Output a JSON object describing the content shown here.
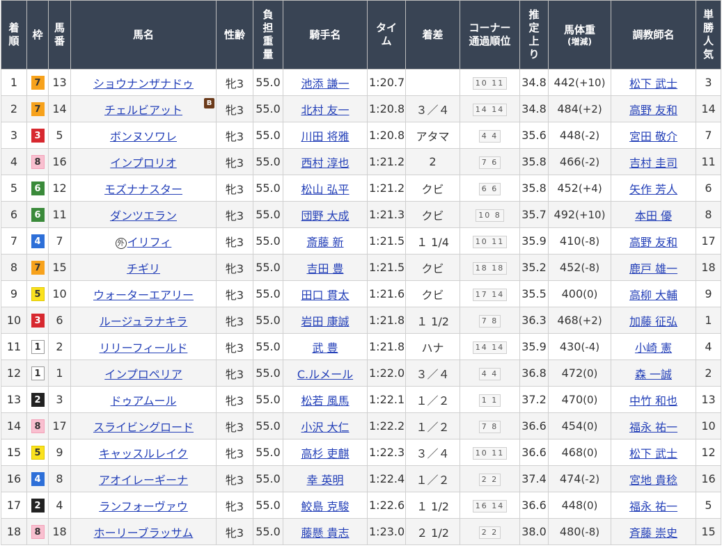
{
  "headers": {
    "rank": "着\n順",
    "waku": "枠",
    "num": "馬\n番",
    "horse": "馬名",
    "sexage": "性齢",
    "burden": "負\n担\n重\n量",
    "jockey": "騎手名",
    "time": "タイ\nム",
    "margin": "着差",
    "corner": "コーナー\n通過順位",
    "last3f": "推\n定\n上\nり",
    "weight": "馬体重",
    "weight_sub": "(増減)",
    "trainer": "調教師名",
    "pop": "単\n勝\n人\n気"
  },
  "waku_colors": {
    "1": {
      "bg": "#ffffff",
      "fg": "#333333",
      "border": "#999999"
    },
    "2": {
      "bg": "#222222",
      "fg": "#ffffff",
      "border": "#222222"
    },
    "3": {
      "bg": "#d7282f",
      "fg": "#ffffff",
      "border": "#d7282f"
    },
    "4": {
      "bg": "#2d6fd8",
      "fg": "#ffffff",
      "border": "#2d6fd8"
    },
    "5": {
      "bg": "#fbe21e",
      "fg": "#333333",
      "border": "#e0c800"
    },
    "6": {
      "bg": "#3a8a3a",
      "fg": "#ffffff",
      "border": "#3a8a3a"
    },
    "7": {
      "bg": "#f7a21c",
      "fg": "#333333",
      "border": "#f7a21c"
    },
    "8": {
      "bg": "#f9c0d0",
      "fg": "#333333",
      "border": "#f3a0b8"
    }
  },
  "rows": [
    {
      "rank": "1",
      "waku": "7",
      "num": "13",
      "horse": "ショウナンザナドゥ",
      "blinker": "",
      "mark": "",
      "sexage": "牝3",
      "burden": "55.0",
      "jockey": "池添 謙一",
      "time": "1:20.7",
      "margin": "",
      "corner": "10 11",
      "last3f": "34.8",
      "weight": "442",
      "diff": "(+10)",
      "trainer": "松下 武士",
      "pop": "3"
    },
    {
      "rank": "2",
      "waku": "7",
      "num": "14",
      "horse": "チェルビアット",
      "blinker": "B",
      "mark": "",
      "sexage": "牝3",
      "burden": "55.0",
      "jockey": "北村 友一",
      "time": "1:20.8",
      "margin": "３／４",
      "corner": "14 14",
      "last3f": "34.8",
      "weight": "484",
      "diff": "(+2)",
      "trainer": "高野 友和",
      "pop": "14"
    },
    {
      "rank": "3",
      "waku": "3",
      "num": "5",
      "horse": "ボンヌソワレ",
      "blinker": "",
      "mark": "",
      "sexage": "牝3",
      "burden": "55.0",
      "jockey": "川田 将雅",
      "time": "1:20.8",
      "margin": "アタマ",
      "corner": "4 4",
      "last3f": "35.6",
      "weight": "448",
      "diff": "(-2)",
      "trainer": "宮田 敬介",
      "pop": "7"
    },
    {
      "rank": "4",
      "waku": "8",
      "num": "16",
      "horse": "インプロリオ",
      "blinker": "",
      "mark": "",
      "sexage": "牝3",
      "burden": "55.0",
      "jockey": "西村 淳也",
      "time": "1:21.2",
      "margin": "2",
      "corner": "7 6",
      "last3f": "35.8",
      "weight": "466",
      "diff": "(-2)",
      "trainer": "吉村 圭司",
      "pop": "11"
    },
    {
      "rank": "5",
      "waku": "6",
      "num": "12",
      "horse": "モズナナスター",
      "blinker": "",
      "mark": "",
      "sexage": "牝3",
      "burden": "55.0",
      "jockey": "松山 弘平",
      "time": "1:21.2",
      "margin": "クビ",
      "corner": "6 6",
      "last3f": "35.8",
      "weight": "452",
      "diff": "(+4)",
      "trainer": "矢作 芳人",
      "pop": "6"
    },
    {
      "rank": "6",
      "waku": "6",
      "num": "11",
      "horse": "ダンツエラン",
      "blinker": "",
      "mark": "",
      "sexage": "牝3",
      "burden": "55.0",
      "jockey": "団野 大成",
      "time": "1:21.3",
      "margin": "クビ",
      "corner": "10 8",
      "last3f": "35.7",
      "weight": "492",
      "diff": "(+10)",
      "trainer": "本田 優",
      "pop": "8"
    },
    {
      "rank": "7",
      "waku": "4",
      "num": "7",
      "horse": "イリフィ",
      "blinker": "",
      "mark": "外",
      "sexage": "牝3",
      "burden": "55.0",
      "jockey": "斎藤 新",
      "time": "1:21.5",
      "margin": "１ 1/4",
      "corner": "10 11",
      "last3f": "35.9",
      "weight": "410",
      "diff": "(-8)",
      "trainer": "高野 友和",
      "pop": "17"
    },
    {
      "rank": "8",
      "waku": "7",
      "num": "15",
      "horse": "チギリ",
      "blinker": "",
      "mark": "",
      "sexage": "牝3",
      "burden": "55.0",
      "jockey": "吉田 豊",
      "time": "1:21.5",
      "margin": "クビ",
      "corner": "18 18",
      "last3f": "35.2",
      "weight": "452",
      "diff": "(-8)",
      "trainer": "鹿戸 雄一",
      "pop": "18"
    },
    {
      "rank": "9",
      "waku": "5",
      "num": "10",
      "horse": "ウォーターエアリー",
      "blinker": "",
      "mark": "",
      "sexage": "牝3",
      "burden": "55.0",
      "jockey": "田口 貫太",
      "time": "1:21.6",
      "margin": "クビ",
      "corner": "17 14",
      "last3f": "35.5",
      "weight": "400",
      "diff": "(0)",
      "trainer": "高柳 大輔",
      "pop": "9"
    },
    {
      "rank": "10",
      "waku": "3",
      "num": "6",
      "horse": "ルージュラナキラ",
      "blinker": "",
      "mark": "",
      "sexage": "牝3",
      "burden": "55.0",
      "jockey": "岩田 康誠",
      "time": "1:21.8",
      "margin": "１ 1/2",
      "corner": "7 8",
      "last3f": "36.3",
      "weight": "468",
      "diff": "(+2)",
      "trainer": "加藤 征弘",
      "pop": "1"
    },
    {
      "rank": "11",
      "waku": "1",
      "num": "2",
      "horse": "リリーフィールド",
      "blinker": "",
      "mark": "",
      "sexage": "牝3",
      "burden": "55.0",
      "jockey": "武 豊",
      "time": "1:21.8",
      "margin": "ハナ",
      "corner": "14 14",
      "last3f": "35.9",
      "weight": "430",
      "diff": "(-4)",
      "trainer": "小崎 憲",
      "pop": "4"
    },
    {
      "rank": "12",
      "waku": "1",
      "num": "1",
      "horse": "インプロペリア",
      "blinker": "",
      "mark": "",
      "sexage": "牝3",
      "burden": "55.0",
      "jockey": "C.ルメール",
      "time": "1:22.0",
      "margin": "３／４",
      "corner": "4 4",
      "last3f": "36.8",
      "weight": "472",
      "diff": "(0)",
      "trainer": "森 一誠",
      "pop": "2"
    },
    {
      "rank": "13",
      "waku": "2",
      "num": "3",
      "horse": "ドゥアムール",
      "blinker": "",
      "mark": "",
      "sexage": "牝3",
      "burden": "55.0",
      "jockey": "松若 風馬",
      "time": "1:22.1",
      "margin": "１／２",
      "corner": "1 1",
      "last3f": "37.2",
      "weight": "470",
      "diff": "(0)",
      "trainer": "中竹 和也",
      "pop": "13"
    },
    {
      "rank": "14",
      "waku": "8",
      "num": "17",
      "horse": "スライビングロード",
      "blinker": "",
      "mark": "",
      "sexage": "牝3",
      "burden": "55.0",
      "jockey": "小沢 大仁",
      "time": "1:22.2",
      "margin": "１／２",
      "corner": "7 8",
      "last3f": "36.6",
      "weight": "454",
      "diff": "(0)",
      "trainer": "福永 祐一",
      "pop": "10"
    },
    {
      "rank": "15",
      "waku": "5",
      "num": "9",
      "horse": "キャッスルレイク",
      "blinker": "",
      "mark": "",
      "sexage": "牝3",
      "burden": "55.0",
      "jockey": "高杉 吏麒",
      "time": "1:22.3",
      "margin": "３／４",
      "corner": "10 11",
      "last3f": "36.6",
      "weight": "468",
      "diff": "(0)",
      "trainer": "松下 武士",
      "pop": "12"
    },
    {
      "rank": "16",
      "waku": "4",
      "num": "8",
      "horse": "アオイレーギーナ",
      "blinker": "",
      "mark": "",
      "sexage": "牝3",
      "burden": "55.0",
      "jockey": "幸 英明",
      "time": "1:22.4",
      "margin": "１／２",
      "corner": "2 2",
      "last3f": "37.4",
      "weight": "474",
      "diff": "(-2)",
      "trainer": "宮地 貴稔",
      "pop": "16"
    },
    {
      "rank": "17",
      "waku": "2",
      "num": "4",
      "horse": "ランフォーヴァウ",
      "blinker": "",
      "mark": "",
      "sexage": "牝3",
      "burden": "55.0",
      "jockey": "鮫島 克駿",
      "time": "1:22.6",
      "margin": "１ 1/2",
      "corner": "16 14",
      "last3f": "36.6",
      "weight": "448",
      "diff": "(0)",
      "trainer": "福永 祐一",
      "pop": "5"
    },
    {
      "rank": "18",
      "waku": "8",
      "num": "18",
      "horse": "ホーリーブラッサム",
      "blinker": "",
      "mark": "",
      "sexage": "牝3",
      "burden": "55.0",
      "jockey": "藤懸 貴志",
      "time": "1:23.0",
      "margin": "２ 1/2",
      "corner": "2 2",
      "last3f": "38.0",
      "weight": "480",
      "diff": "(-8)",
      "trainer": "斉藤 崇史",
      "pop": "15"
    }
  ]
}
